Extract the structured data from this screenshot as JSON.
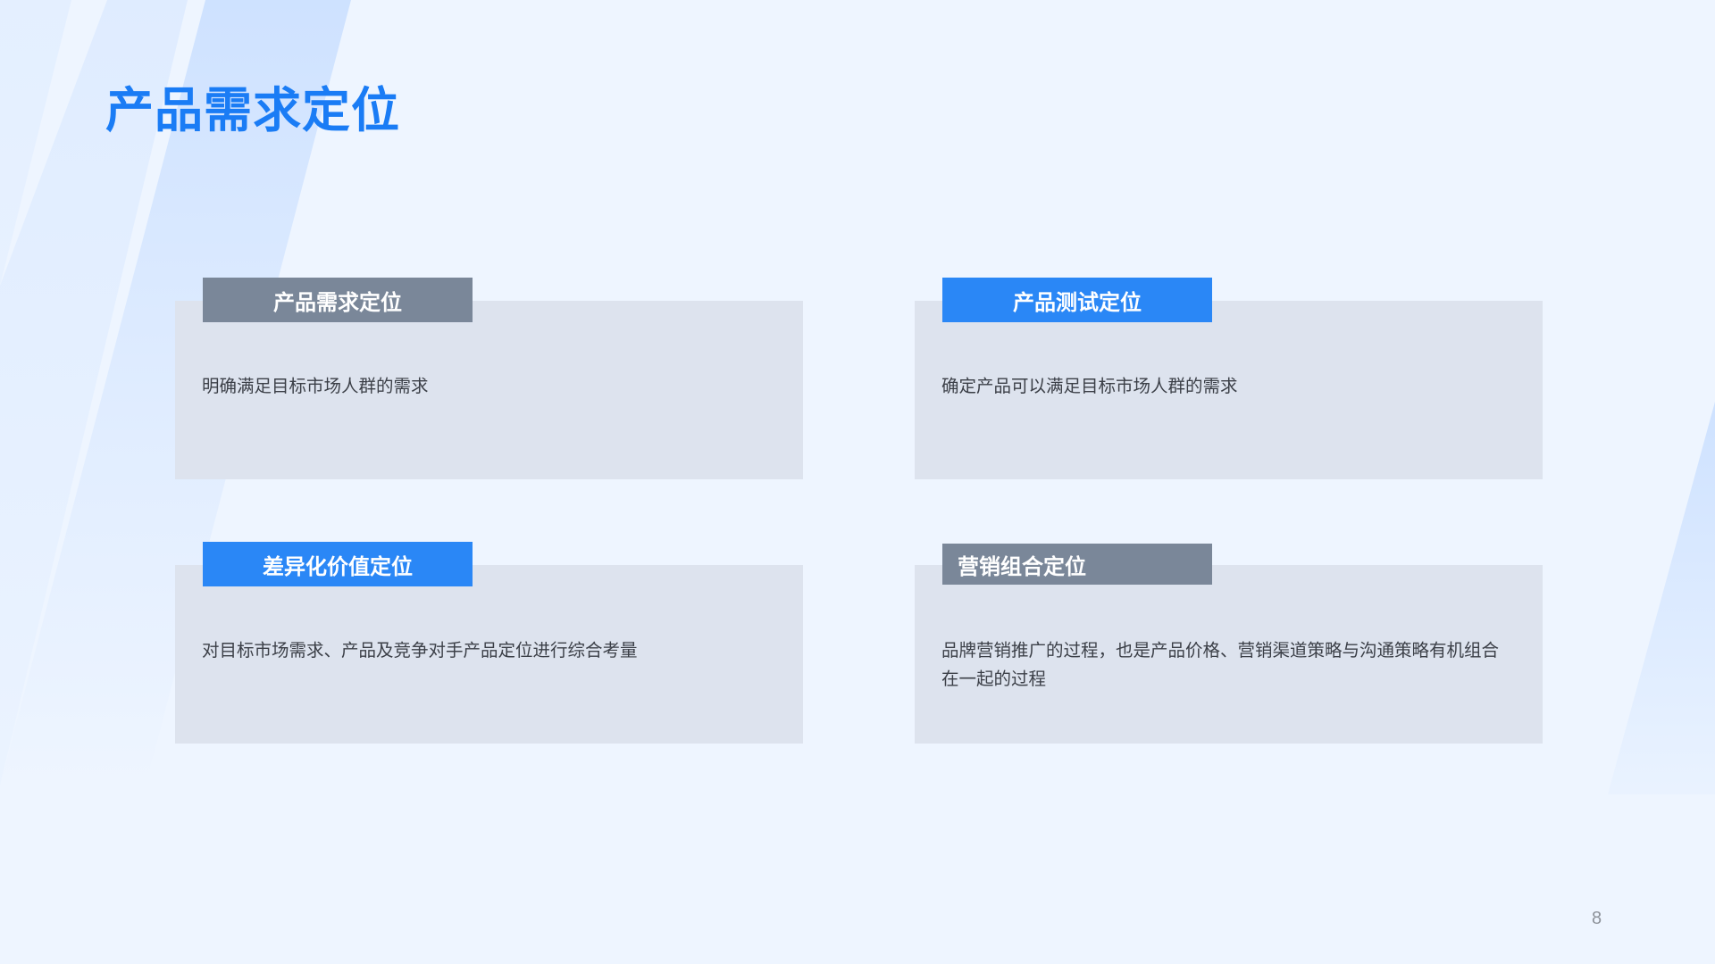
{
  "slide": {
    "title": "产品需求定位",
    "page_number": "8"
  },
  "cards": [
    {
      "label": "产品需求定位",
      "text": "明确满足目标市场人群的需求",
      "tag_color": "#7a8799"
    },
    {
      "label": "产品测试定位",
      "text": "确定产品可以满足目标市场人群的需求",
      "tag_color": "#2a87f6"
    },
    {
      "label": "差异化价值定位",
      "text": "对目标市场需求、产品及竞争对手产品定位进行综合考量",
      "tag_color": "#2a87f6"
    },
    {
      "label": "营销组合定位",
      "text": "品牌营销推广的过程，也是产品价格、营销渠道策略与沟通策略有机组合在一起的过程",
      "tag_color": "#7a8799"
    }
  ],
  "colors": {
    "background": "#eef5ff",
    "title": "#1a7cf5",
    "card_background": "#dde3ee",
    "accent_blue": "#2a87f6",
    "accent_gray": "#7a8799"
  }
}
